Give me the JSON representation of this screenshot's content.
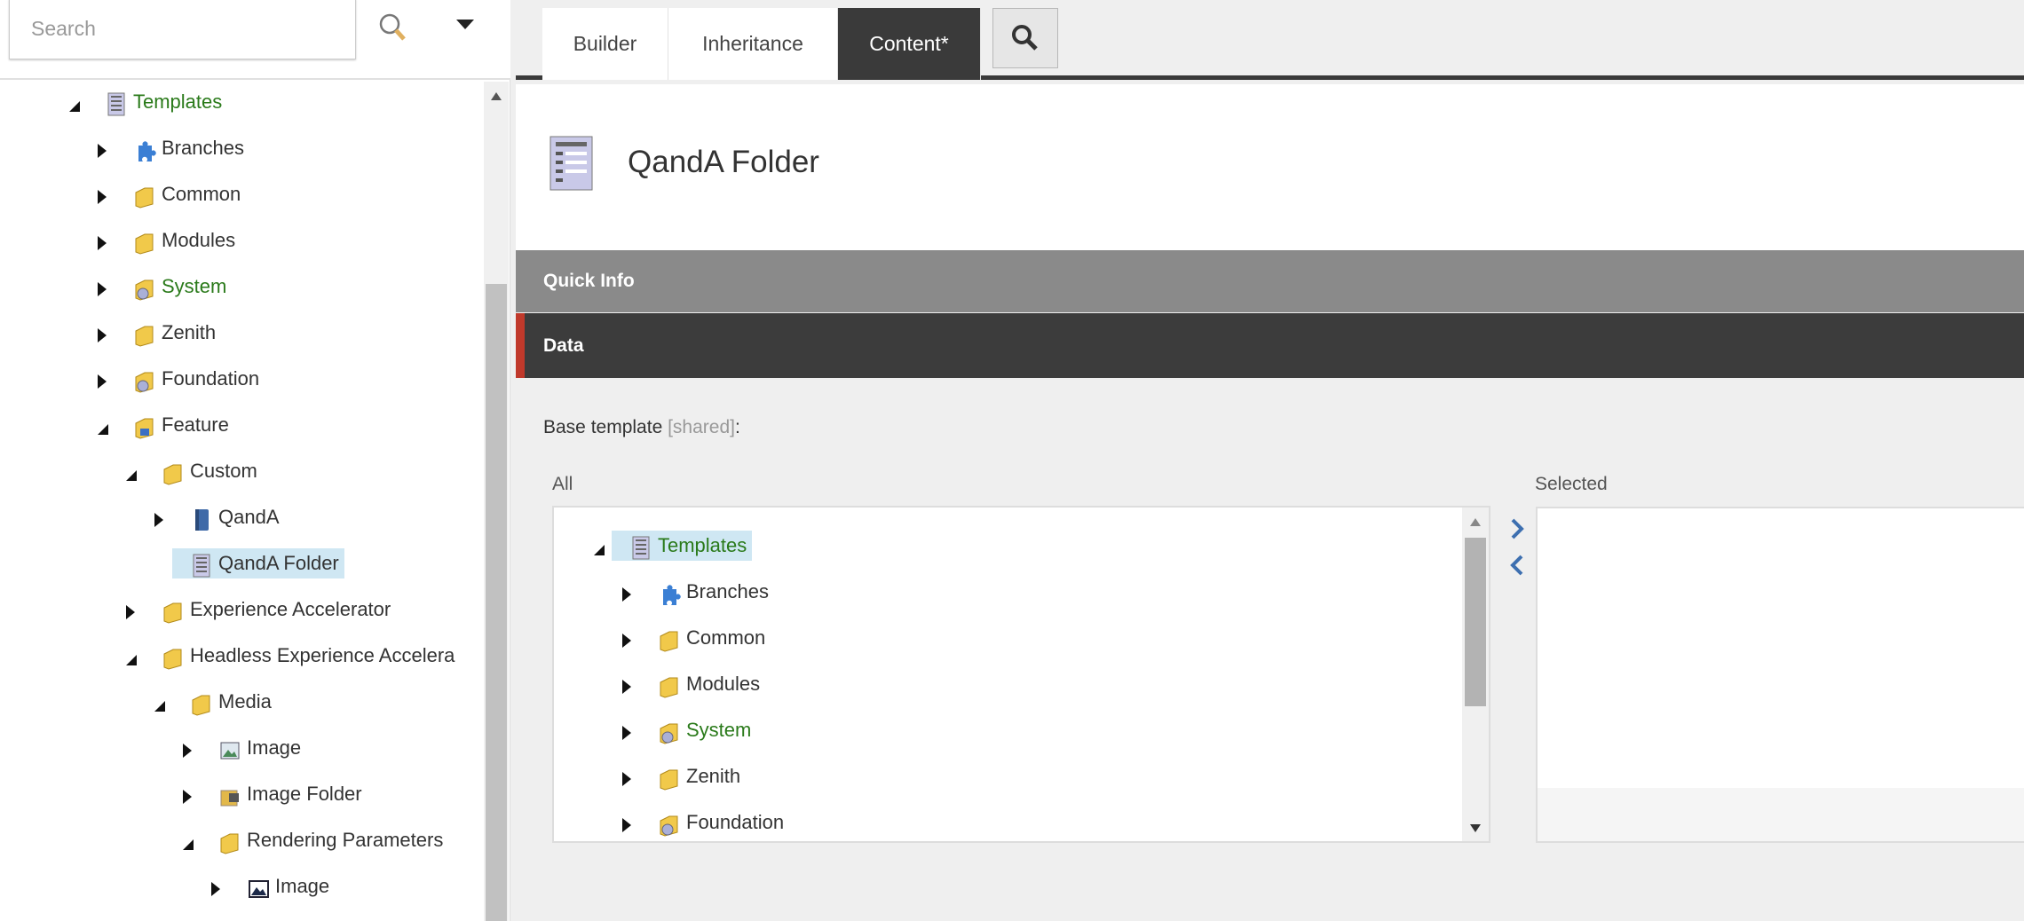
{
  "search": {
    "placeholder": "Search"
  },
  "content_tree": [
    {
      "label": "Templates",
      "level": 0,
      "state": "open",
      "icon": "template-icon",
      "color": "green"
    },
    {
      "label": "Branches",
      "level": 1,
      "state": "closed",
      "icon": "puzzle-icon"
    },
    {
      "label": "Common",
      "level": 1,
      "state": "closed",
      "icon": "folder-icon"
    },
    {
      "label": "Modules",
      "level": 1,
      "state": "closed",
      "icon": "folder-icon"
    },
    {
      "label": "System",
      "level": 1,
      "state": "closed",
      "icon": "system-folder-icon",
      "color": "green"
    },
    {
      "label": "Zenith",
      "level": 1,
      "state": "closed",
      "icon": "folder-icon"
    },
    {
      "label": "Foundation",
      "level": 1,
      "state": "closed",
      "icon": "system-folder-icon"
    },
    {
      "label": "Feature",
      "level": 1,
      "state": "open",
      "icon": "feature-folder-icon"
    },
    {
      "label": "Custom",
      "level": 2,
      "state": "open",
      "icon": "folder-icon"
    },
    {
      "label": "QandA",
      "level": 3,
      "state": "closed",
      "icon": "book-icon"
    },
    {
      "label": "QandA Folder",
      "level": 3,
      "state": "none",
      "icon": "template-icon",
      "selected": true
    },
    {
      "label": "Experience Accelerator",
      "level": 2,
      "state": "closed",
      "icon": "folder-icon"
    },
    {
      "label": "Headless Experience Accelera",
      "level": 2,
      "state": "open",
      "icon": "folder-icon"
    },
    {
      "label": "Media",
      "level": 3,
      "state": "open",
      "icon": "folder-icon"
    },
    {
      "label": "Image",
      "level": 4,
      "state": "closed",
      "icon": "image-icon"
    },
    {
      "label": "Image Folder",
      "level": 4,
      "state": "closed",
      "icon": "image-folder-icon"
    },
    {
      "label": "Rendering Parameters",
      "level": 4,
      "state": "open",
      "icon": "folder-icon"
    },
    {
      "label": "Image",
      "level": 5,
      "state": "closed",
      "icon": "image-dark-icon"
    }
  ],
  "tabs": [
    {
      "label": "Builder"
    },
    {
      "label": "Inheritance"
    },
    {
      "label": "Content*",
      "active": true
    }
  ],
  "item": {
    "title": "QandA Folder"
  },
  "sections": {
    "quick_info": "Quick Info",
    "data": "Data"
  },
  "field": {
    "label": "Base template",
    "shared": "[shared]",
    "colon": ":",
    "all_label": "All",
    "selected_label": "Selected"
  },
  "all_tree": [
    {
      "label": "Templates",
      "level": 0,
      "state": "open",
      "icon": "template-icon",
      "color": "green",
      "selected": true
    },
    {
      "label": "Branches",
      "level": 1,
      "state": "closed",
      "icon": "puzzle-icon"
    },
    {
      "label": "Common",
      "level": 1,
      "state": "closed",
      "icon": "folder-icon"
    },
    {
      "label": "Modules",
      "level": 1,
      "state": "closed",
      "icon": "folder-icon"
    },
    {
      "label": "System",
      "level": 1,
      "state": "closed",
      "icon": "system-folder-icon",
      "color": "green"
    },
    {
      "label": "Zenith",
      "level": 1,
      "state": "closed",
      "icon": "folder-icon"
    },
    {
      "label": "Foundation",
      "level": 1,
      "state": "closed",
      "icon": "system-folder-icon"
    }
  ],
  "colors": {
    "green": "#2a7a1a",
    "accent_red": "#c0392b",
    "dark": "#3a3a3a",
    "selection": "#cfe7f3"
  }
}
